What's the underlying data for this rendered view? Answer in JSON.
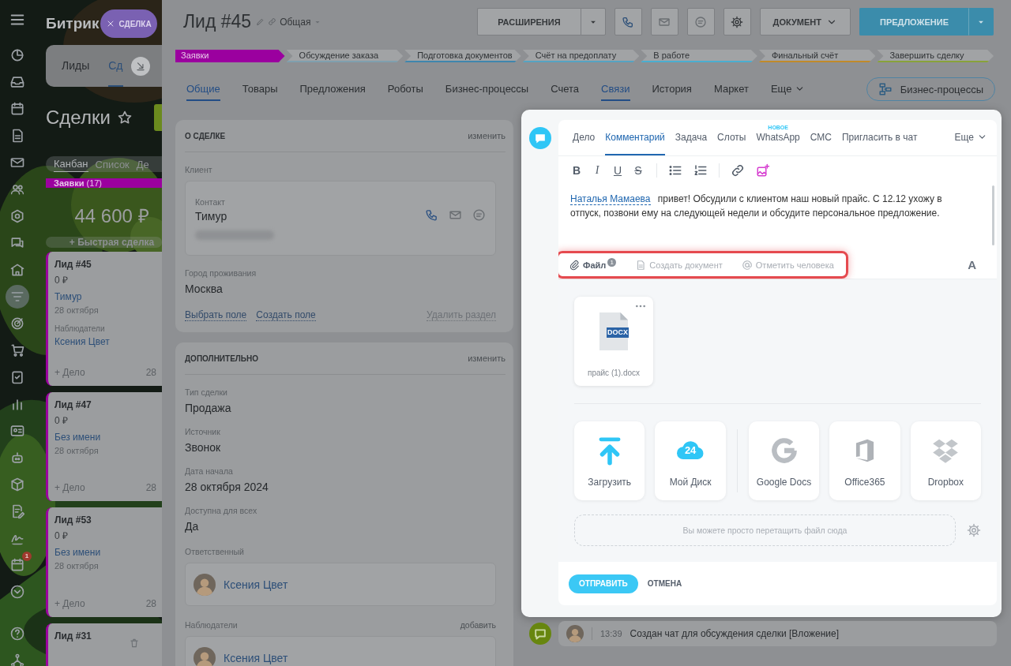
{
  "nav": {
    "items": [
      {
        "kind": "pie",
        "selected": false
      },
      {
        "kind": "inbox",
        "selected": false
      },
      {
        "kind": "calendar",
        "selected": false
      },
      {
        "kind": "document",
        "selected": false
      },
      {
        "kind": "mail",
        "selected": false
      },
      {
        "kind": "people",
        "selected": false
      },
      {
        "kind": "hexagon",
        "selected": false
      },
      {
        "kind": "chat",
        "selected": false
      },
      {
        "kind": "building",
        "selected": false
      },
      {
        "kind": "filter",
        "selected": true
      },
      {
        "kind": "target",
        "selected": false
      },
      {
        "kind": "cart",
        "selected": false
      },
      {
        "kind": "checklist",
        "selected": false
      },
      {
        "kind": "barchart",
        "selected": false
      },
      {
        "kind": "contact",
        "selected": false
      },
      {
        "kind": "robot",
        "selected": false
      },
      {
        "kind": "cube",
        "selected": false
      },
      {
        "kind": "edit",
        "selected": false
      },
      {
        "kind": "signature",
        "selected": false
      },
      {
        "kind": "calendar",
        "selected": false,
        "badge": "1"
      },
      {
        "kind": "expand",
        "selected": false
      },
      {
        "kind": "help",
        "selected": false
      },
      {
        "kind": "network",
        "selected": false
      }
    ]
  },
  "kanban": {
    "logo": "Битрик",
    "chip": "СДЕЛКА",
    "tabs": [
      {
        "label": "Лиды",
        "selected": false
      },
      {
        "label": "Сд",
        "selected": true
      }
    ],
    "title": "Сделки",
    "view_tabs": [
      {
        "label": "Канбан",
        "selected": true
      },
      {
        "label": "Список",
        "selected": false
      },
      {
        "label": "Де",
        "selected": false
      }
    ],
    "stage": {
      "name": "Заявки",
      "count": "(17)",
      "color": "#9b009f"
    },
    "total": "44 600 ₽",
    "quick_add": "+ Быстрая сделка",
    "cards": [
      {
        "title": "Лид #45",
        "amount": "0 ₽",
        "client": "Тимур",
        "date": "28 октября",
        "observers_label": "Наблюдатели",
        "observer": "Ксения Цвет",
        "activity": "+ Дело",
        "date_short": "28"
      },
      {
        "title": "Лид #47",
        "amount": "0 ₽",
        "client": "Без имени",
        "date": "28 октября",
        "activity": "+ Дело",
        "date_short": "28"
      },
      {
        "title": "Лид #53",
        "amount": "0 ₽",
        "client": "Без имени",
        "date": "28 октября",
        "activity": "+ Дело",
        "date_short": "28"
      },
      {
        "title": "Лид #31"
      }
    ]
  },
  "deal": {
    "title": "Лид #45",
    "category": "Общая",
    "extensions": "РАСШИРЕНИЯ",
    "document": "ДОКУМЕНТ",
    "offer": "ПРЕДЛОЖЕНИЕ",
    "stages": [
      {
        "name": "Заявки",
        "color": "#9b009f",
        "selected": true
      },
      {
        "name": "Обсуждение заказа",
        "color": "#7f9fae",
        "selected": false
      },
      {
        "name": "Подготовка документов",
        "color": "#3f86ad",
        "selected": false
      },
      {
        "name": "Счёт на предоплату",
        "color": "#55a3c2",
        "selected": false
      },
      {
        "name": "В работе",
        "color": "#4aaed0",
        "selected": false
      },
      {
        "name": "Финальный счёт",
        "color": "#c08a2a",
        "selected": false
      },
      {
        "name": "Завершить сделку",
        "color": "#88a23a",
        "selected": false
      }
    ],
    "tabs": [
      {
        "label": "Общие",
        "selected": true
      },
      {
        "label": "Товары",
        "selected": false
      },
      {
        "label": "Предложения",
        "selected": false
      },
      {
        "label": "Роботы",
        "selected": false
      },
      {
        "label": "Бизнес-процессы",
        "selected": false
      },
      {
        "label": "Счета",
        "selected": false
      },
      {
        "label": "Связи",
        "selected": true
      },
      {
        "label": "История",
        "selected": false
      },
      {
        "label": "Маркет",
        "selected": false
      },
      {
        "label": "Еще",
        "selected": false
      }
    ],
    "bp_button": "Бизнес-процессы"
  },
  "about": {
    "title": "О СДЕЛКЕ",
    "action": "изменить",
    "client_label": "Клиент",
    "contact": {
      "label": "Контакт",
      "name": "Тимур"
    },
    "fields": [
      {
        "label": "Город проживания",
        "value": "Москва"
      }
    ],
    "links": [
      "Выбрать поле",
      "Создать поле"
    ],
    "delete": "Удалить раздел"
  },
  "extra": {
    "title": "ДОПОЛНИТЕЛЬНО",
    "action": "изменить",
    "fields": [
      {
        "label": "Тип сделки",
        "value": "Продажа"
      },
      {
        "label": "Источник",
        "value": "Звонок"
      },
      {
        "label": "Дата начала",
        "value": "28 октября 2024"
      },
      {
        "label": "Доступна для всех",
        "value": "Да"
      }
    ],
    "responsible": {
      "label": "Ответственный",
      "name": "Ксения Цвет"
    },
    "observers": {
      "label": "Наблюдатели",
      "action": "добавить",
      "name": "Ксения Цвет"
    }
  },
  "composer": {
    "tabs": [
      {
        "label": "Дело",
        "selected": false
      },
      {
        "label": "Комментарий",
        "selected": true
      },
      {
        "label": "Задача",
        "selected": false
      },
      {
        "label": "Слоты",
        "selected": false
      },
      {
        "label": "WhatsApp",
        "selected": false,
        "badge": "НОВОЕ"
      },
      {
        "label": "СМС",
        "selected": false
      },
      {
        "label": "Пригласить в чат",
        "selected": false
      },
      {
        "label": "Еще",
        "selected": false
      }
    ],
    "format_buttons": [
      {
        "label": "B",
        "kind": "bold"
      },
      {
        "label": "I",
        "kind": "italic"
      },
      {
        "label": "U",
        "kind": "underline"
      },
      {
        "label": "S",
        "kind": "strike"
      }
    ],
    "mention": "Наталья Мамаева",
    "message": "привет! Обсудили с клиентом наш новый прайс. С 12.12 ухожу в отпуск, позвони ему на следующей недели и обсудите персональное предложение.",
    "attach_bar": {
      "highlighted": true,
      "items": [
        {
          "kind": "file",
          "label": "Файл",
          "badge": "1",
          "active": true
        },
        {
          "kind": "document",
          "label": "Создать документ",
          "active": false
        },
        {
          "kind": "mention",
          "label": "Отметить человека",
          "active": false
        }
      ],
      "format_toggle": "A"
    },
    "files": [
      {
        "name": "прайс (1).docx",
        "type": "DOCX"
      }
    ],
    "sources": [
      {
        "kind": "upload",
        "label": "Загрузить"
      },
      {
        "kind": "disk",
        "label": "Мой Диск",
        "icon_text": "24"
      },
      {
        "kind": "google",
        "label": "Google Docs"
      },
      {
        "kind": "office",
        "label": "Office365"
      },
      {
        "kind": "dropbox",
        "label": "Dropbox"
      }
    ],
    "drop_hint": "Вы можете просто перетащить файл сюда",
    "send": "ОТПРАВИТЬ",
    "cancel": "ОТМЕНА"
  },
  "timeline": [
    {
      "time": "13:39",
      "text": "Создан чат для обсуждения сделки [Вложение]"
    }
  ]
}
